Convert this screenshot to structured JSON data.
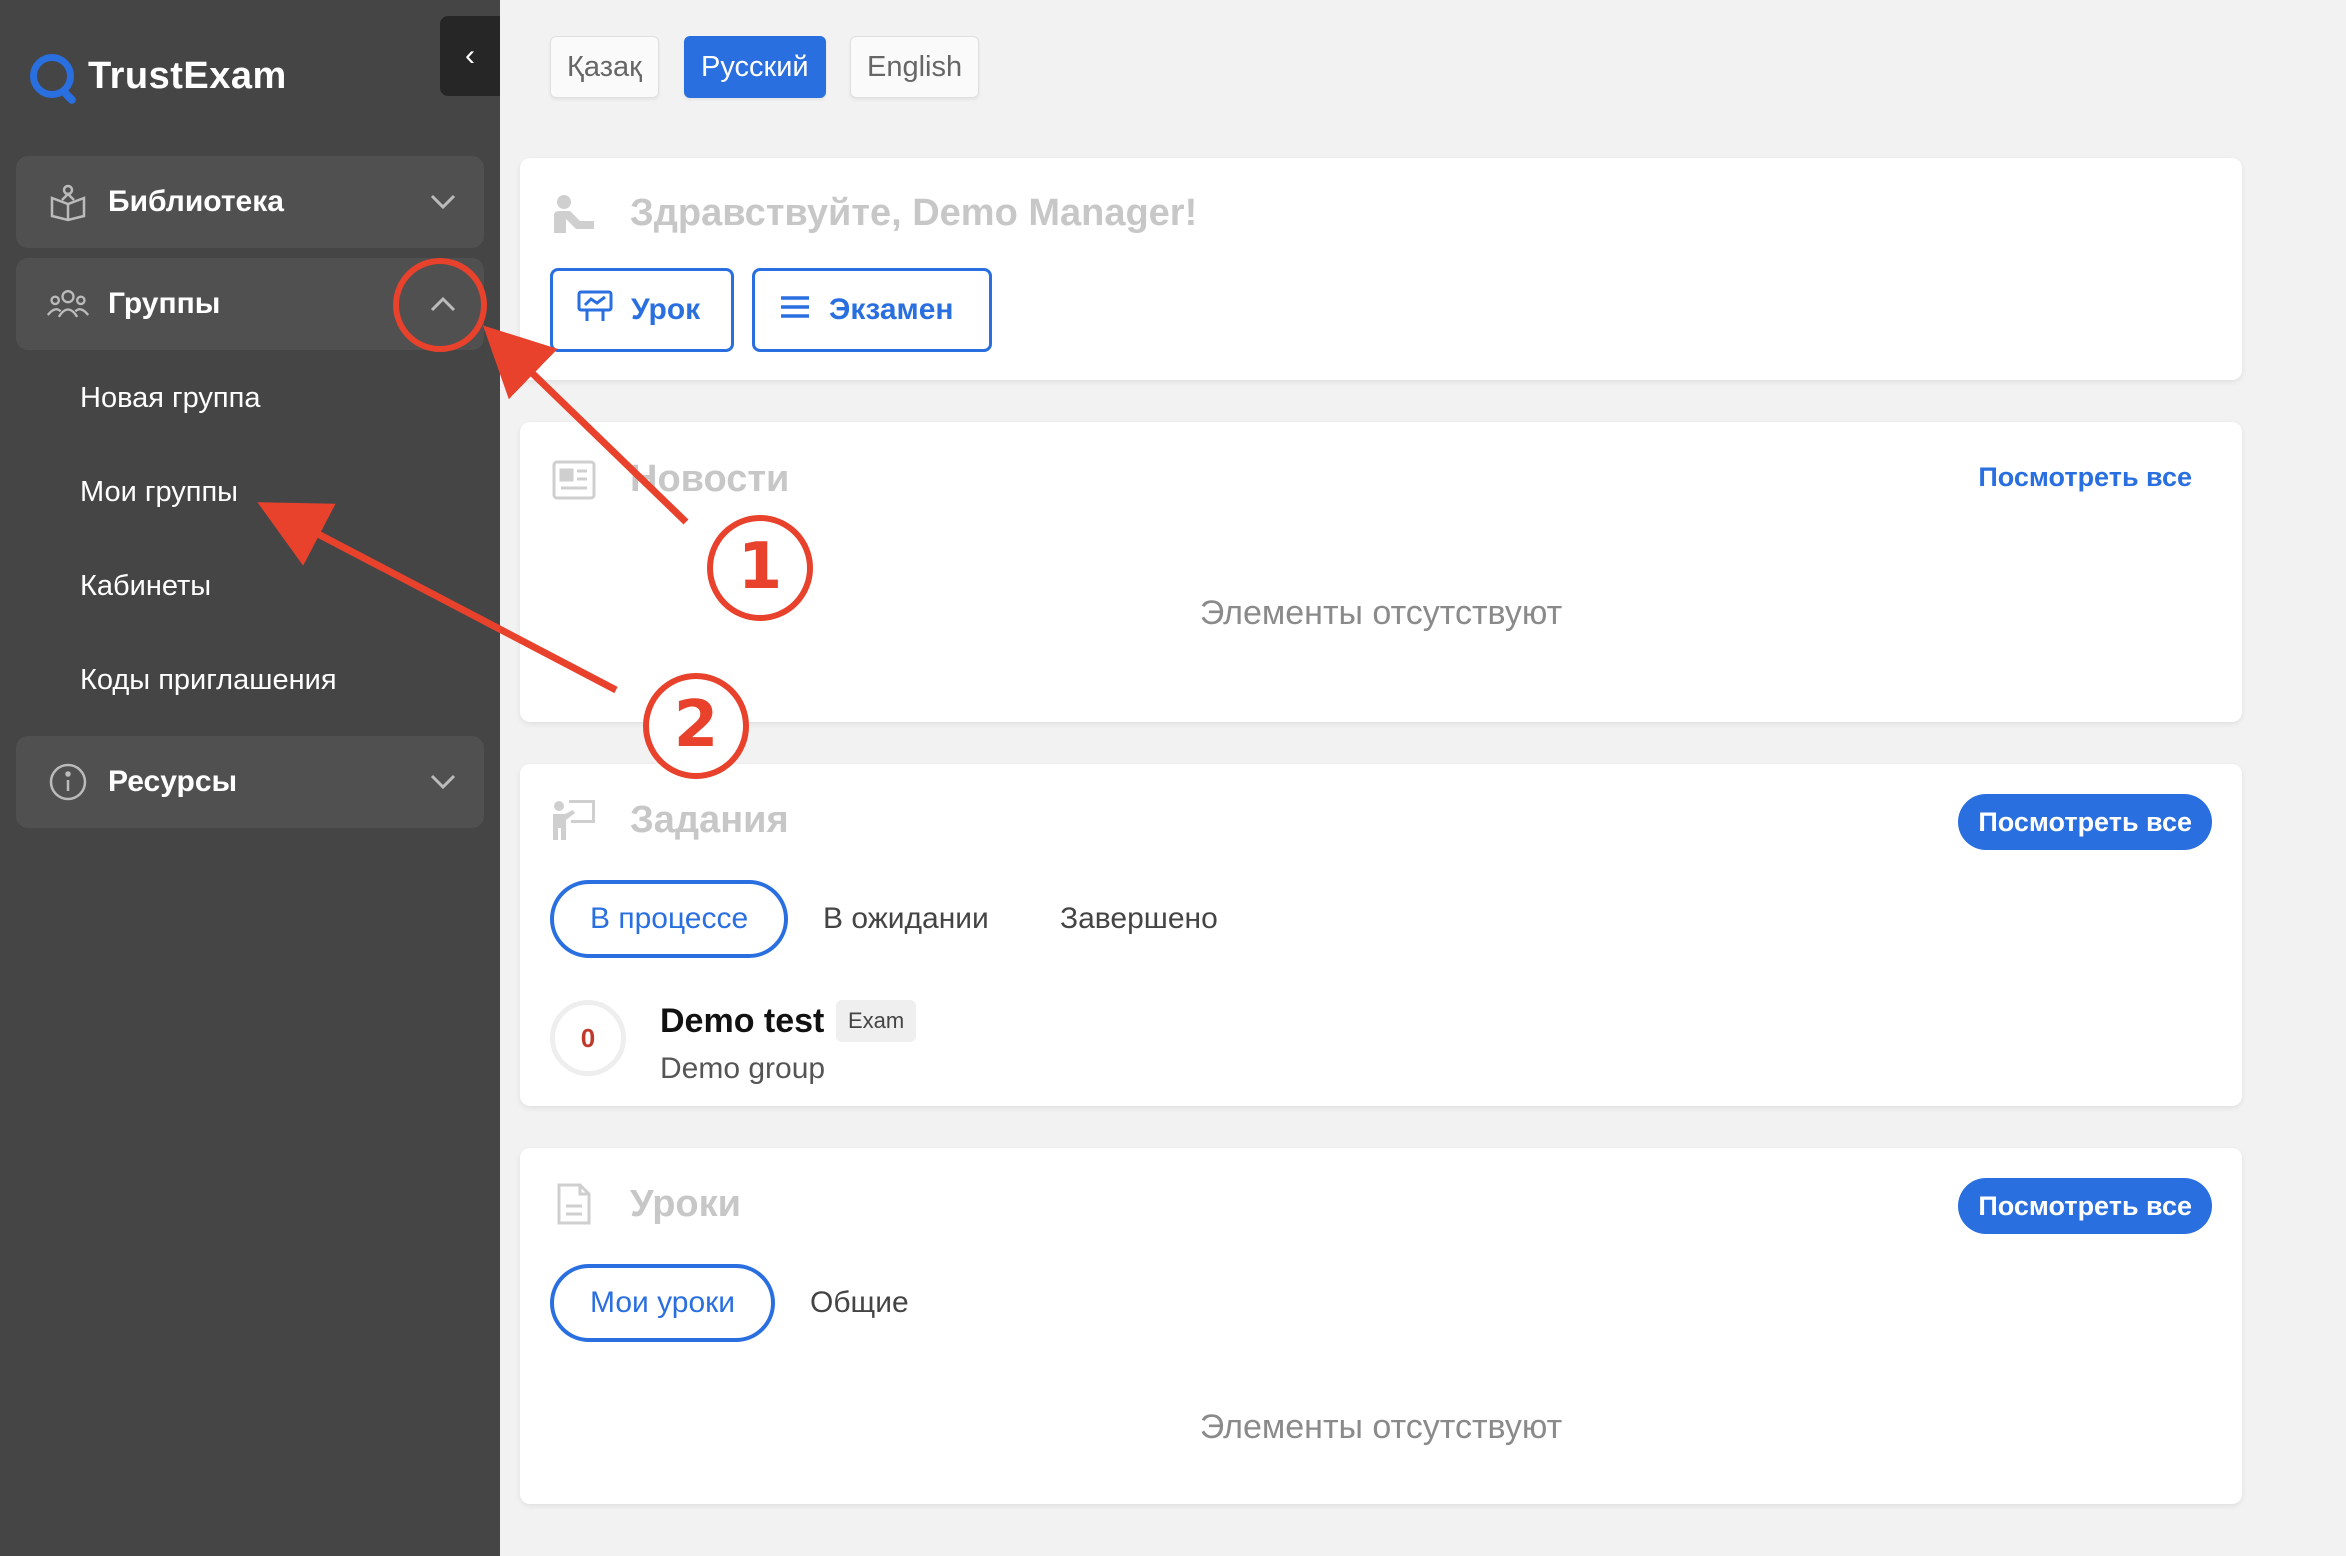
{
  "app": {
    "brand": "TrustExam"
  },
  "sidebar": {
    "collapse_glyph": "‹",
    "groups": [
      {
        "label": "Библиотека",
        "icon": "book-icon",
        "expanded": false
      },
      {
        "label": "Группы",
        "icon": "people-icon",
        "expanded": true
      },
      {
        "label": "Ресурсы",
        "icon": "info-icon",
        "expanded": false
      }
    ],
    "group_subitems": [
      "Новая группа",
      "Мои группы",
      "Кабинеты",
      "Коды приглашения"
    ]
  },
  "languages": [
    {
      "label": "Қазақ",
      "active": false
    },
    {
      "label": "Русский",
      "active": true
    },
    {
      "label": "English",
      "active": false
    }
  ],
  "welcome": {
    "greeting": "Здравствуйте, Demo Manager!",
    "lesson_button": "Урок",
    "exam_button": "Экзамен"
  },
  "news": {
    "title": "Новости",
    "view_all": "Посмотреть все",
    "empty": "Элементы отсутствуют"
  },
  "tasks": {
    "title": "Задания",
    "view_all": "Посмотреть все",
    "tabs": [
      "В процессе",
      "В ожидании",
      "Завершено"
    ],
    "items": [
      {
        "score": "0",
        "name": "Demo test",
        "badge": "Exam",
        "group": "Demo group"
      }
    ]
  },
  "lessons": {
    "title": "Уроки",
    "view_all": "Посмотреть все",
    "tabs": [
      "Мои уроки",
      "Общие"
    ],
    "empty": "Элементы отсутствуют"
  },
  "annotations": {
    "step1": "1",
    "step2": "2"
  },
  "colors": {
    "accent": "#2a6fe0",
    "sidebar_bg": "#454545",
    "annotation": "#e8412c"
  }
}
